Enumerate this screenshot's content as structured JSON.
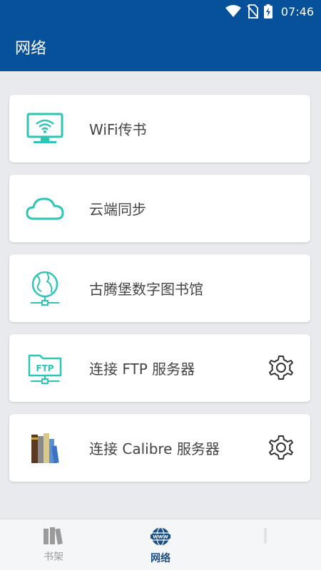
{
  "status_bar": {
    "time": "07:46"
  },
  "app_bar": {
    "title": "网络"
  },
  "menu_items": [
    {
      "label": "WiFi传书",
      "icon": "wifi-monitor-icon",
      "has_settings": false
    },
    {
      "label": "云端同步",
      "icon": "cloud-icon",
      "has_settings": false
    },
    {
      "label": "古腾堡数字图书馆",
      "icon": "globe-network-icon",
      "has_settings": false
    },
    {
      "label": "连接 FTP 服务器",
      "icon": "ftp-folder-icon",
      "has_settings": true
    },
    {
      "label": "连接 Calibre 服务器",
      "icon": "calibre-books-icon",
      "has_settings": true
    }
  ],
  "bottom_nav": [
    {
      "label": "书架",
      "icon": "bookshelf-icon",
      "active": false
    },
    {
      "label": "网络",
      "icon": "www-globe-icon",
      "active": true
    }
  ],
  "colors": {
    "primary": "#07519a",
    "accent": "#2ec4b6",
    "background": "#e8eaed"
  }
}
